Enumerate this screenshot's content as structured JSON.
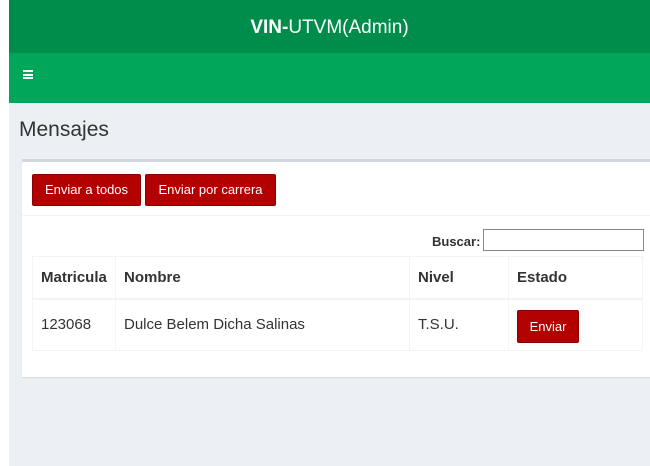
{
  "header": {
    "brand_bold": "VIN-",
    "brand_rest": "UTVM(Admin)"
  },
  "nav": {
    "menu_icon": "hamburger-icon"
  },
  "page": {
    "title": "Mensajes"
  },
  "toolbar": {
    "send_all_label": "Enviar a todos",
    "send_by_career_label": "Enviar por carrera"
  },
  "search": {
    "label": "Buscar:",
    "value": "",
    "placeholder": ""
  },
  "table": {
    "columns": [
      "Matricula",
      "Nombre",
      "Nivel",
      "Estado"
    ],
    "rows": [
      {
        "matricula": "123068",
        "nombre": "Dulce Belem Dicha Salinas",
        "nivel": "T.S.U.",
        "estado_button": "Enviar"
      }
    ]
  },
  "colors": {
    "header_dark_green": "#008d4c",
    "nav_green": "#00a65a",
    "button_red": "#b30000",
    "page_bg": "#ecf0f5"
  }
}
